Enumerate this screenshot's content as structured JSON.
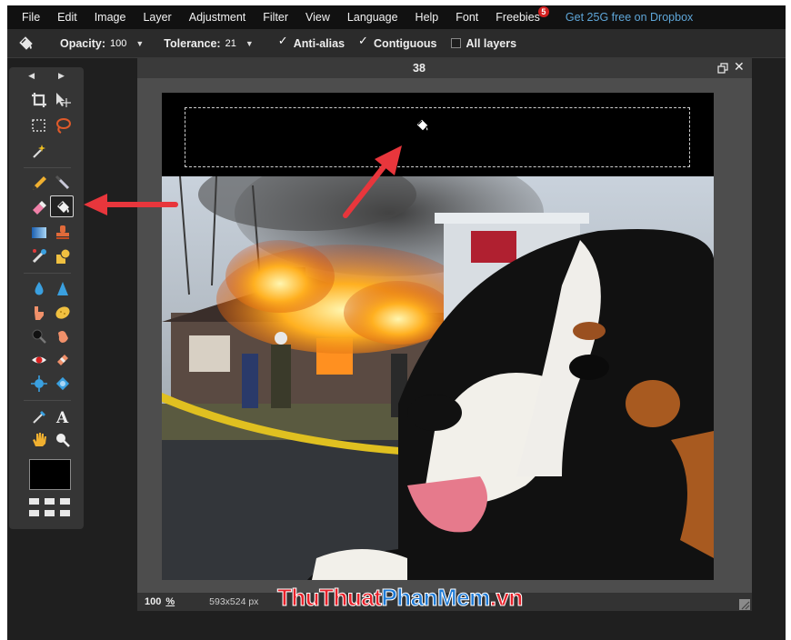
{
  "menubar": {
    "items": [
      "File",
      "Edit",
      "Image",
      "Layer",
      "Adjustment",
      "Filter",
      "View",
      "Language",
      "Help",
      "Font",
      "Freebies"
    ],
    "freebies_badge": "5",
    "promo": "Get 25G free on Dropbox"
  },
  "toolbar": {
    "opacity_label": "Opacity:",
    "opacity_value": "100",
    "tolerance_label": "Tolerance:",
    "tolerance_value": "21",
    "antialias_label": "Anti-alias",
    "antialias_checked": true,
    "contiguous_label": "Contiguous",
    "contiguous_checked": true,
    "all_layers_label": "All layers",
    "all_layers_checked": false
  },
  "tools_panel": {
    "tools": [
      "crop-icon",
      "move-icon",
      "marquee-icon",
      "lasso-icon",
      "magic-wand-icon",
      "pencil-icon",
      "brush-icon",
      "eraser-icon",
      "paint-bucket-icon",
      "gradient-icon",
      "clone-stamp-icon",
      "color-replace-icon",
      "shape-icon",
      "blur-icon",
      "sharpen-icon",
      "smudge-icon",
      "sponge-icon",
      "dodge-icon",
      "burn-icon",
      "red-eye-icon",
      "spot-heal-icon",
      "bloat-icon",
      "pinch-icon",
      "color-picker-icon",
      "type-icon",
      "hand-icon",
      "zoom-icon"
    ],
    "active_tool": "paint-bucket-icon",
    "primary_color": "#000000"
  },
  "document": {
    "title": "38",
    "zoom": "100",
    "zoom_unit": "%",
    "dimensions": "593x524 px"
  },
  "watermark": {
    "part1": "ThuThuat",
    "part2": "PhanMem",
    "part3": ".vn"
  },
  "colors": {
    "app_bg": "#1f1f1f",
    "menubar_bg": "#111111",
    "accent_link": "#5ea6d8",
    "annotation_arrow": "#e8363c"
  }
}
